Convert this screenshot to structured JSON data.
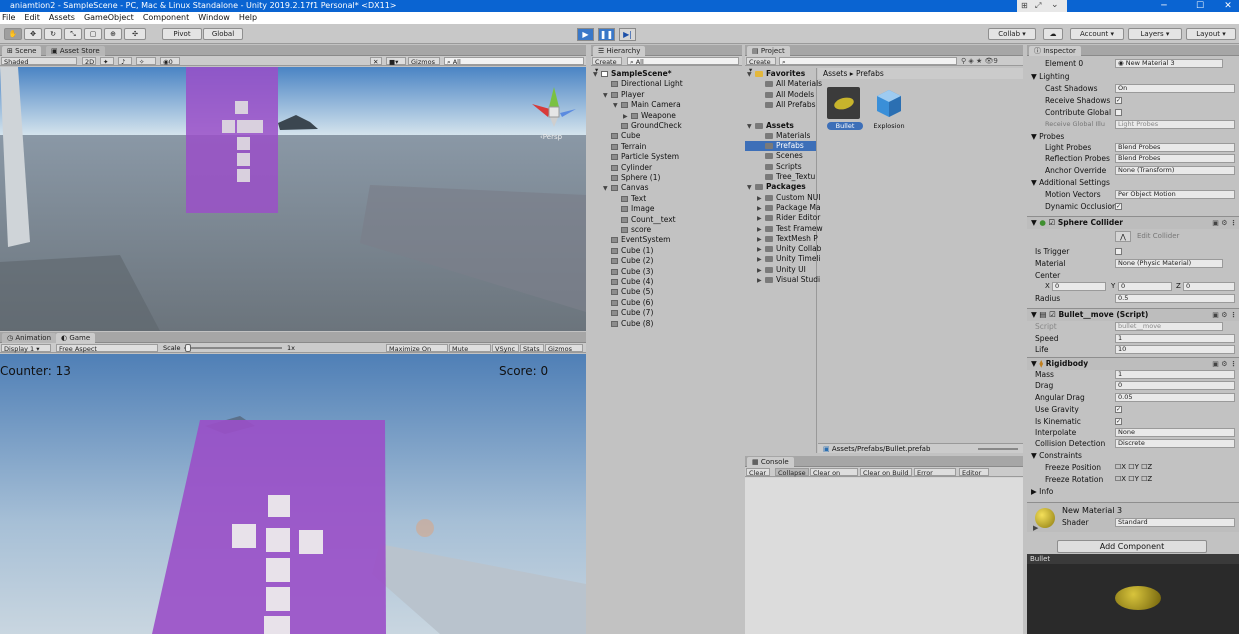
{
  "window": {
    "title": "aniamtion2 - SampleScene - PC, Mac & Linux Standalone - Unity 2019.2.17f1 Personal* <DX11>"
  },
  "menu": [
    "File",
    "Edit",
    "Assets",
    "GameObject",
    "Component",
    "Window",
    "Help"
  ],
  "toolbar": {
    "pivot": "Pivot",
    "global": "Global",
    "collab": "Collab ▾",
    "account": "Account",
    "layers": "Layers",
    "layout": "Layout"
  },
  "scene_panel": {
    "tabs": [
      "Scene",
      "Asset Store"
    ],
    "shading": "Shaded",
    "mode2d": "2D",
    "gizmos": "Gizmos",
    "search": "All",
    "axis_label": "‹Persp"
  },
  "game_panel": {
    "tabs": [
      "Animation",
      "Game"
    ],
    "display": "Display 1",
    "aspect": "Free Aspect",
    "scale_label": "Scale",
    "scale_value": "1x",
    "buttons": [
      "Maximize On Play",
      "Mute Audio",
      "VSync",
      "Stats",
      "Gizmos"
    ],
    "counter_text": "Counter: 13",
    "score_text": "Score: 0"
  },
  "hierarchy": {
    "tab": "Hierarchy",
    "create": "Create",
    "search": "All",
    "items": [
      {
        "label": "SampleScene*",
        "depth": 0,
        "arrow": "▼",
        "scene": true
      },
      {
        "label": "Directional Light",
        "depth": 1,
        "arrow": ""
      },
      {
        "label": "Player",
        "depth": 1,
        "arrow": "▼"
      },
      {
        "label": "Main Camera",
        "depth": 2,
        "arrow": "▼"
      },
      {
        "label": "Weapone",
        "depth": 3,
        "arrow": "▶"
      },
      {
        "label": "GroundCheck",
        "depth": 2,
        "arrow": ""
      },
      {
        "label": "Cube",
        "depth": 1,
        "arrow": ""
      },
      {
        "label": "Terrain",
        "depth": 1,
        "arrow": ""
      },
      {
        "label": "Particle System",
        "depth": 1,
        "arrow": ""
      },
      {
        "label": "Cylinder",
        "depth": 1,
        "arrow": ""
      },
      {
        "label": "Sphere (1)",
        "depth": 1,
        "arrow": ""
      },
      {
        "label": "Canvas",
        "depth": 1,
        "arrow": "▼"
      },
      {
        "label": "Text",
        "depth": 2,
        "arrow": ""
      },
      {
        "label": "Image",
        "depth": 2,
        "arrow": ""
      },
      {
        "label": "Count__text",
        "depth": 2,
        "arrow": ""
      },
      {
        "label": "score",
        "depth": 2,
        "arrow": ""
      },
      {
        "label": "EventSystem",
        "depth": 1,
        "arrow": ""
      },
      {
        "label": "Cube (1)",
        "depth": 1,
        "arrow": ""
      },
      {
        "label": "Cube (2)",
        "depth": 1,
        "arrow": ""
      },
      {
        "label": "Cube (3)",
        "depth": 1,
        "arrow": ""
      },
      {
        "label": "Cube (4)",
        "depth": 1,
        "arrow": ""
      },
      {
        "label": "Cube (5)",
        "depth": 1,
        "arrow": ""
      },
      {
        "label": "Cube (6)",
        "depth": 1,
        "arrow": ""
      },
      {
        "label": "Cube (7)",
        "depth": 1,
        "arrow": ""
      },
      {
        "label": "Cube (8)",
        "depth": 1,
        "arrow": ""
      }
    ]
  },
  "project": {
    "tab": "Project",
    "create": "Create",
    "tree": [
      {
        "label": "Favorites",
        "depth": 0,
        "arrow": "▼",
        "bold": true,
        "star": true
      },
      {
        "label": "All Materials",
        "depth": 1,
        "arrow": ""
      },
      {
        "label": "All Models",
        "depth": 1,
        "arrow": ""
      },
      {
        "label": "All Prefabs",
        "depth": 1,
        "arrow": ""
      },
      {
        "label": "",
        "depth": 0,
        "arrow": ""
      },
      {
        "label": "Assets",
        "depth": 0,
        "arrow": "▼",
        "bold": true
      },
      {
        "label": "Materials",
        "depth": 1,
        "arrow": ""
      },
      {
        "label": "Prefabs",
        "depth": 1,
        "arrow": "",
        "selected": true
      },
      {
        "label": "Scenes",
        "depth": 1,
        "arrow": ""
      },
      {
        "label": "Scripts",
        "depth": 1,
        "arrow": ""
      },
      {
        "label": "Tree_Textu",
        "depth": 1,
        "arrow": ""
      },
      {
        "label": "Packages",
        "depth": 0,
        "arrow": "▼",
        "bold": true
      },
      {
        "label": "Custom NUI",
        "depth": 1,
        "arrow": "▶"
      },
      {
        "label": "Package Ma",
        "depth": 1,
        "arrow": "▶"
      },
      {
        "label": "Rider Editor",
        "depth": 1,
        "arrow": "▶"
      },
      {
        "label": "Test Framew",
        "depth": 1,
        "arrow": "▶"
      },
      {
        "label": "TextMesh P",
        "depth": 1,
        "arrow": "▶"
      },
      {
        "label": "Unity Collab",
        "depth": 1,
        "arrow": "▶"
      },
      {
        "label": "Unity Timeli",
        "depth": 1,
        "arrow": "▶"
      },
      {
        "label": "Unity UI",
        "depth": 1,
        "arrow": "▶"
      },
      {
        "label": "Visual Studi",
        "depth": 1,
        "arrow": "▶"
      }
    ],
    "breadcrumb": [
      "Assets",
      "Prefabs"
    ],
    "assets": [
      {
        "label": "Bullet",
        "selected": true
      },
      {
        "label": "Explosion",
        "selected": false
      }
    ],
    "footer_path": "Assets/Prefabs/Bullet.prefab"
  },
  "console": {
    "tab": "Console",
    "buttons": [
      "Clear",
      "Collapse",
      "Clear on Play",
      "Clear on Build",
      "Error Pause",
      "Editor ▾"
    ]
  },
  "inspector": {
    "tab": "Inspector",
    "element0_label": "Element 0",
    "element0_value": "New Material 3",
    "lighting": {
      "header": "Lighting",
      "cast_shadows_label": "Cast Shadows",
      "cast_shadows": "On",
      "receive_shadows_label": "Receive Shadows",
      "contribute_gi_label": "Contribute Global",
      "receive_gi_label": "Receive Global Illu",
      "receive_gi": "Light Probes"
    },
    "probes": {
      "header": "Probes",
      "light_probes_label": "Light Probes",
      "light_probes": "Blend Probes",
      "reflection_label": "Reflection Probes",
      "reflection": "Blend Probes",
      "anchor_label": "Anchor Override",
      "anchor": "None (Transform)"
    },
    "additional": {
      "header": "Additional Settings",
      "motion_label": "Motion Vectors",
      "motion": "Per Object Motion",
      "dynamic_label": "Dynamic Occlusion"
    },
    "sphere_collider": {
      "title": "Sphere Collider",
      "edit_label": "Edit Collider",
      "is_trigger_label": "Is Trigger",
      "material_label": "Material",
      "material": "None (Physic Material)",
      "center_label": "Center",
      "x": "0",
      "y": "0",
      "z": "0",
      "radius_label": "Radius",
      "radius": "0.5"
    },
    "script": {
      "title": "Bullet__move (Script)",
      "script_label": "Script",
      "script_value": "bullet__move",
      "speed_label": "Speed",
      "speed": "1",
      "life_label": "Life",
      "life": "10"
    },
    "rigidbody": {
      "title": "Rigidbody",
      "mass_label": "Mass",
      "mass": "1",
      "drag_label": "Drag",
      "drag": "0",
      "angular_label": "Angular Drag",
      "angular": "0.05",
      "gravity_label": "Use Gravity",
      "kinematic_label": "Is Kinematic",
      "interpolate_label": "Interpolate",
      "interpolate": "None",
      "collision_label": "Collision Detection",
      "collision": "Discrete",
      "constraints_header": "Constraints",
      "freeze_pos_label": "Freeze Position",
      "freeze_rot_label": "Freeze Rotation",
      "info": "Info"
    },
    "material": {
      "name": "New Material 3",
      "shader_label": "Shader",
      "shader": "Standard"
    },
    "add_component": "Add Component",
    "preview_label": "Bullet"
  },
  "colors": {
    "titlebar": "#0a64d2",
    "panel": "#c2c2c2",
    "selection": "#3d6fb8",
    "purple": "#9a4fc8",
    "bullet": "#c8b42c",
    "explosion": "#3a8fd8"
  }
}
